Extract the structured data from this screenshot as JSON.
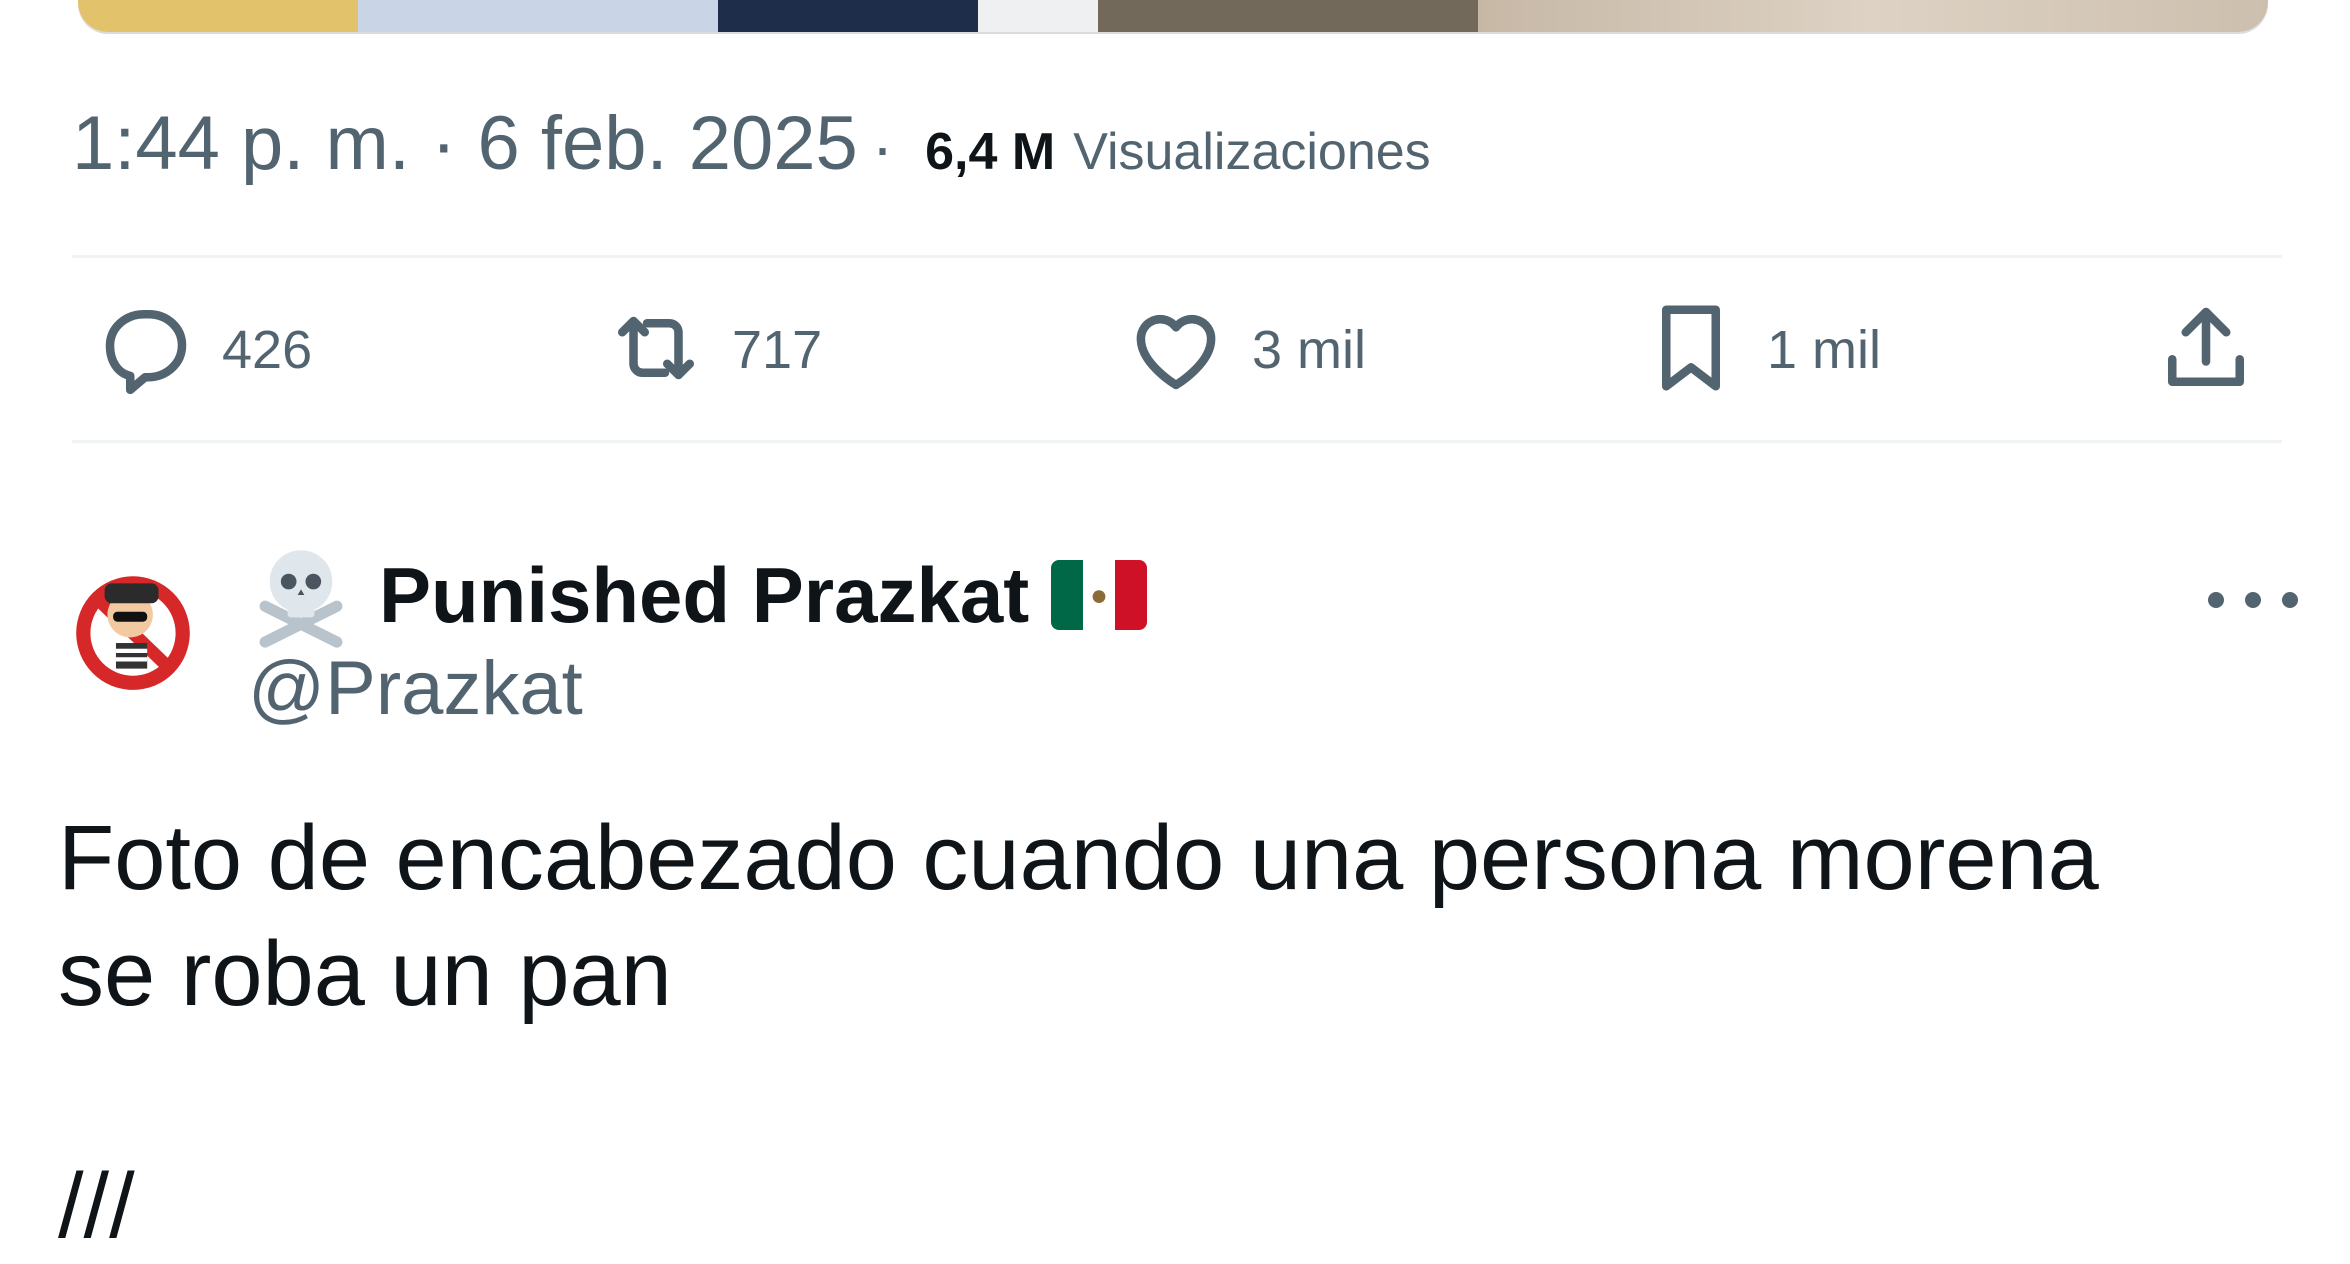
{
  "previous_tweet": {
    "timestamp": "1:44 p. m. · 6 feb. 2025",
    "separator": "·",
    "views_count": "6,4 M",
    "views_label": "Visualizaciones"
  },
  "actions": {
    "reply_count": "426",
    "retweet_count": "717",
    "like_count": "3 mil",
    "bookmark_count": "1 mil"
  },
  "tweet": {
    "author_name": "Punished Prazkat",
    "author_handle": "@Prazkat",
    "text": "Foto de encabezado cuando una persona morena\nse roba un pan\n\n///"
  },
  "colors": {
    "text_primary": "#0f1419",
    "text_secondary": "#536471",
    "divider": "#eff3f4",
    "flag_green": "#006847",
    "flag_red": "#ce1126"
  },
  "icons": {
    "reply": "speech-bubble-icon",
    "retweet": "retweet-arrows-icon",
    "like": "heart-icon",
    "bookmark": "bookmark-icon",
    "share": "upload-share-icon",
    "more": "more-dots-icon",
    "skull": "skull-crossbones-icon",
    "flag": "mexico-flag-icon"
  }
}
